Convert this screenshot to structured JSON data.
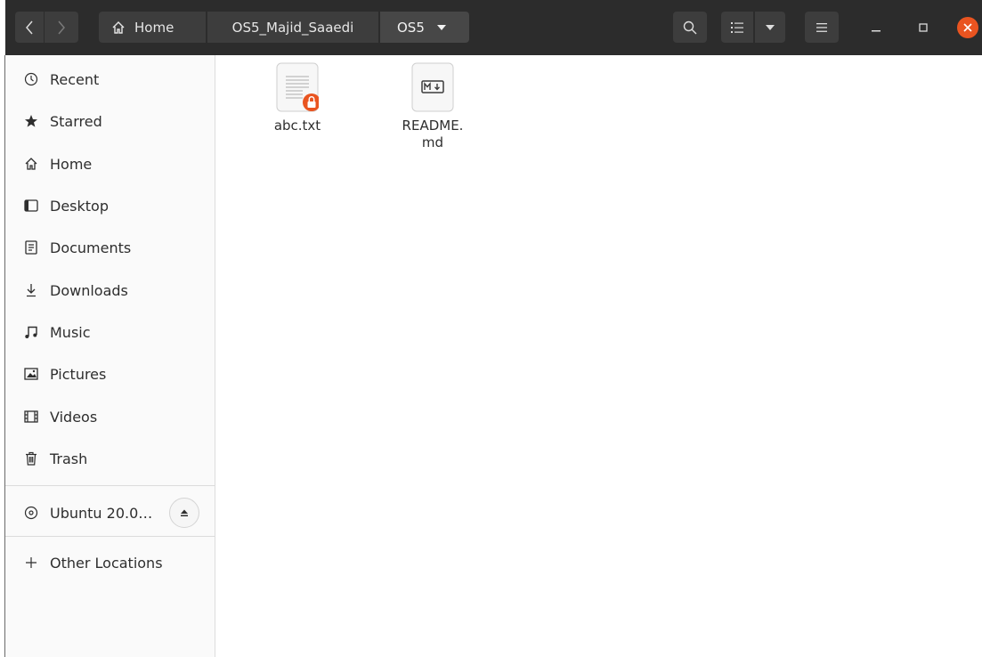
{
  "nav": {
    "back_icon": "chevron-left-icon",
    "forward_icon": "chevron-right-icon"
  },
  "breadcrumb": {
    "home_label": "Home",
    "dir_label": "OS5_Majid_Saaedi",
    "current_label": "OS5"
  },
  "toolbar": {
    "search_icon": "search-icon",
    "view_icon": "list-view-icon",
    "view_menu_icon": "caret-down-icon",
    "menu_icon": "hamburger-icon"
  },
  "window_controls": {
    "minimize_icon": "minimize-icon",
    "maximize_icon": "maximize-icon",
    "close_icon": "close-icon",
    "close_color": "#e95420"
  },
  "sidebar": {
    "items": [
      {
        "label": "Recent",
        "icon": "clock-icon"
      },
      {
        "label": "Starred",
        "icon": "star-icon"
      },
      {
        "label": "Home",
        "icon": "home-icon"
      },
      {
        "label": "Desktop",
        "icon": "desktop-icon"
      },
      {
        "label": "Documents",
        "icon": "document-icon"
      },
      {
        "label": "Downloads",
        "icon": "download-icon"
      },
      {
        "label": "Music",
        "icon": "music-icon"
      },
      {
        "label": "Pictures",
        "icon": "picture-icon"
      },
      {
        "label": "Videos",
        "icon": "video-icon"
      },
      {
        "label": "Trash",
        "icon": "trash-icon"
      }
    ],
    "device": {
      "label": "Ubuntu 20.0…",
      "icon": "disc-icon",
      "eject_icon": "eject-icon"
    },
    "other": {
      "label": "Other Locations",
      "icon": "plus-icon"
    }
  },
  "files": [
    {
      "name": "abc.txt",
      "icon": "text-file-locked-icon"
    },
    {
      "name": "README.md",
      "name_line1": "README.",
      "name_line2": "md",
      "icon": "markdown-file-icon"
    }
  ],
  "colors": {
    "header_bg": "#2c2c2c",
    "button_bg": "#3d3d3d",
    "accent": "#e95420",
    "sidebar_bg": "#fafafa"
  }
}
